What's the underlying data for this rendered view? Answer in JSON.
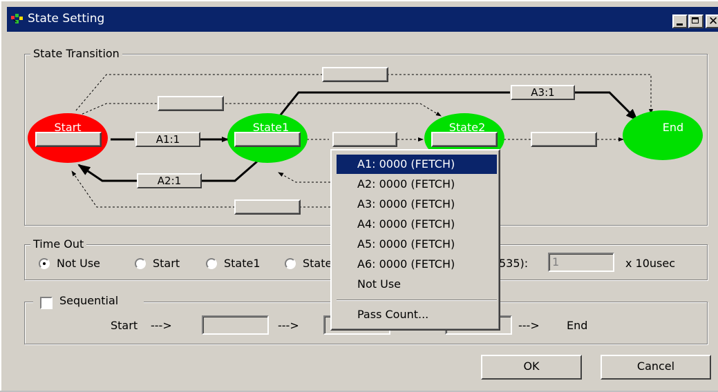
{
  "window": {
    "title": "State Setting"
  },
  "transition": {
    "legend": "State Transition",
    "states": {
      "start": "Start",
      "state1": "State1",
      "state2": "State2",
      "end": "End"
    },
    "edge_labels": {
      "a1": "A1:1",
      "a2": "A2:1",
      "a3": "A3:1"
    }
  },
  "context_menu": {
    "items": [
      "A1: 0000 (FETCH)",
      "A2: 0000 (FETCH)",
      "A3: 0000 (FETCH)",
      "A4: 0000 (FETCH)",
      "A5: 0000 (FETCH)",
      "A6: 0000 (FETCH)",
      "Not Use"
    ],
    "highlighted_index": 0,
    "pass_count": "Pass Count..."
  },
  "timeout": {
    "legend": "Time Out",
    "options": [
      "Not Use",
      "Start",
      "State1",
      "State"
    ],
    "selected": "Not Use",
    "range_suffix": "535):",
    "value": "1",
    "unit": "x 10usec"
  },
  "sequential": {
    "label": "Sequential",
    "checked": false,
    "start": "Start",
    "arrow": "--->",
    "end": "End"
  },
  "buttons": {
    "ok": "OK",
    "cancel": "Cancel"
  },
  "colors": {
    "start": "#ff0000",
    "state": "#00e000",
    "titlebar": "#0a246a",
    "face": "#d4d0c8"
  }
}
